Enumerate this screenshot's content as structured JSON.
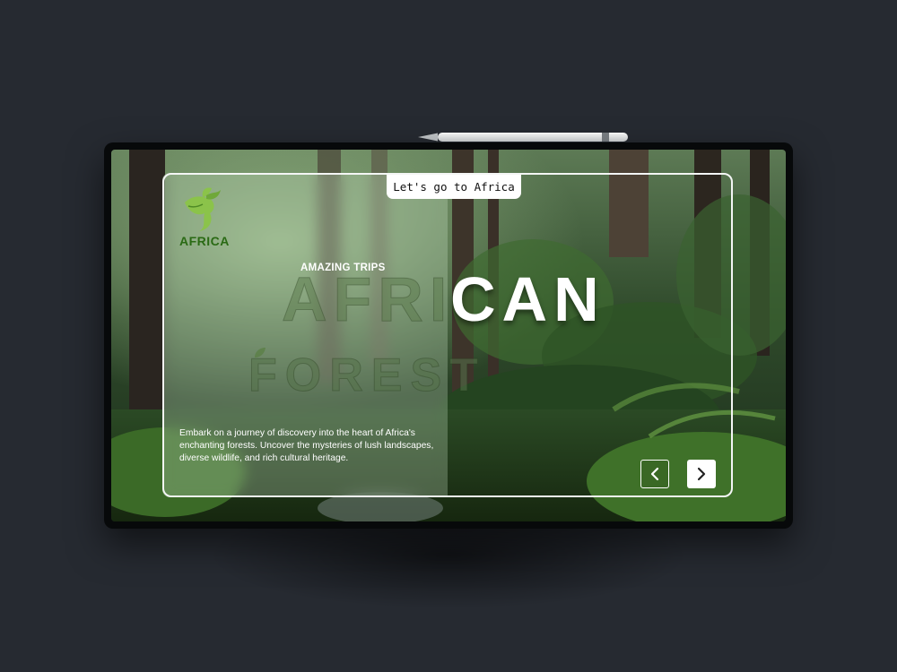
{
  "pill": {
    "label": "Let's go to Africa"
  },
  "logo": {
    "text": "AFRICA"
  },
  "hero": {
    "eyebrow": "AMAZING TRIPS",
    "title_left": "AFRI",
    "title_right": "CAN",
    "subtitle": "FOREST",
    "description": "Embark on a journey of discovery into the heart of Africa's enchanting forests. Uncover the mysteries of lush landscapes, diverse wildlife, and rich cultural heritage."
  },
  "nav": {
    "prev_icon": "chevron-left-icon",
    "next_icon": "chevron-right-icon"
  },
  "colors": {
    "background": "#262a31",
    "frame": "#f4f6f5",
    "logo_green": "#2a6a14",
    "leaf_green": "#8bc34a"
  }
}
